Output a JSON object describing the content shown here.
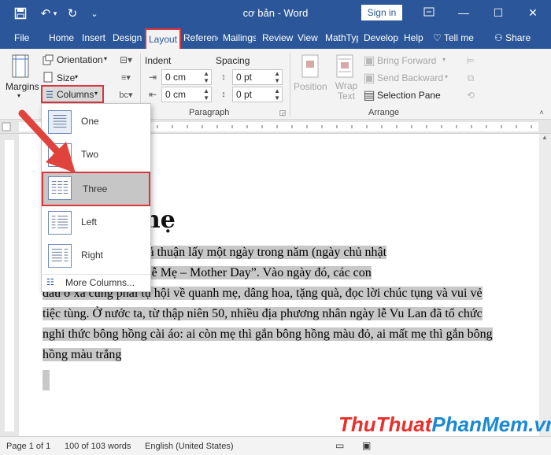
{
  "titlebar": {
    "doc_title": "cơ bản - Word",
    "signin": "Sign in"
  },
  "tabs": [
    {
      "label": "File"
    },
    {
      "label": "Home"
    },
    {
      "label": "Insert"
    },
    {
      "label": "Design"
    },
    {
      "label": "Layout"
    },
    {
      "label": "References"
    },
    {
      "label": "Mailings"
    },
    {
      "label": "Review"
    },
    {
      "label": "View"
    },
    {
      "label": "MathType"
    },
    {
      "label": "Develop"
    },
    {
      "label": "Help"
    }
  ],
  "tell_me": "Tell me",
  "share": "Share",
  "ribbon": {
    "margins": "Margins",
    "orientation": "Orientation",
    "size": "Size",
    "columns": "Columns",
    "indent_label": "Indent",
    "spacing_label": "Spacing",
    "indent_left": "0 cm",
    "indent_right": "0 cm",
    "spacing_before": "0 pt",
    "spacing_after": "0 pt",
    "paragraph_group": "Paragraph",
    "position": "Position",
    "wrap_text": "Wrap Text",
    "bring_forward": "Bring Forward",
    "send_backward": "Send Backward",
    "selection_pane": "Selection Pane",
    "arrange_group": "Arrange"
  },
  "columns_menu": {
    "items": [
      {
        "label": "One"
      },
      {
        "label": "Two"
      },
      {
        "label": "Three"
      },
      {
        "label": "Left"
      },
      {
        "label": "Right"
      }
    ],
    "more": "More Columns..."
  },
  "document": {
    "heading": "mẹ",
    "lines": [
      "thế giới, người ta thoả thuận lấy một ngày trong năm (ngày chủ nhật",
      "năm)   đặt   làm“ Ngày lễ Mẹ – Mother Day”. Vào ngày đó, các con",
      "dâu ở xa cũng phải tụ hội về quanh mẹ, dâng hoa, tặng quà, đọc lời chúc tụng và vui vẻ",
      "tiệc tùng. Ở nước ta,  từ thập niên 50, nhiều địa phương nhân ngày lễ Vu Lan đã tổ chức",
      "nghi thức bông hồng cài áo: ai còn mẹ thì gắn bông hồng màu đỏ, ai mất mẹ thì gắn bông",
      "hồng màu trắng"
    ]
  },
  "status": {
    "page": "Page 1 of 1",
    "words": "100 of 103 words",
    "language": "English (United States)"
  },
  "watermark": {
    "part1": "Thu",
    "part2": "Thuat",
    "part3": "PhanMem",
    "part4": ".vn"
  },
  "colors": {
    "accent": "#2b579a",
    "highlight_box": "#d9363e",
    "selection": "#c8c8c8"
  }
}
